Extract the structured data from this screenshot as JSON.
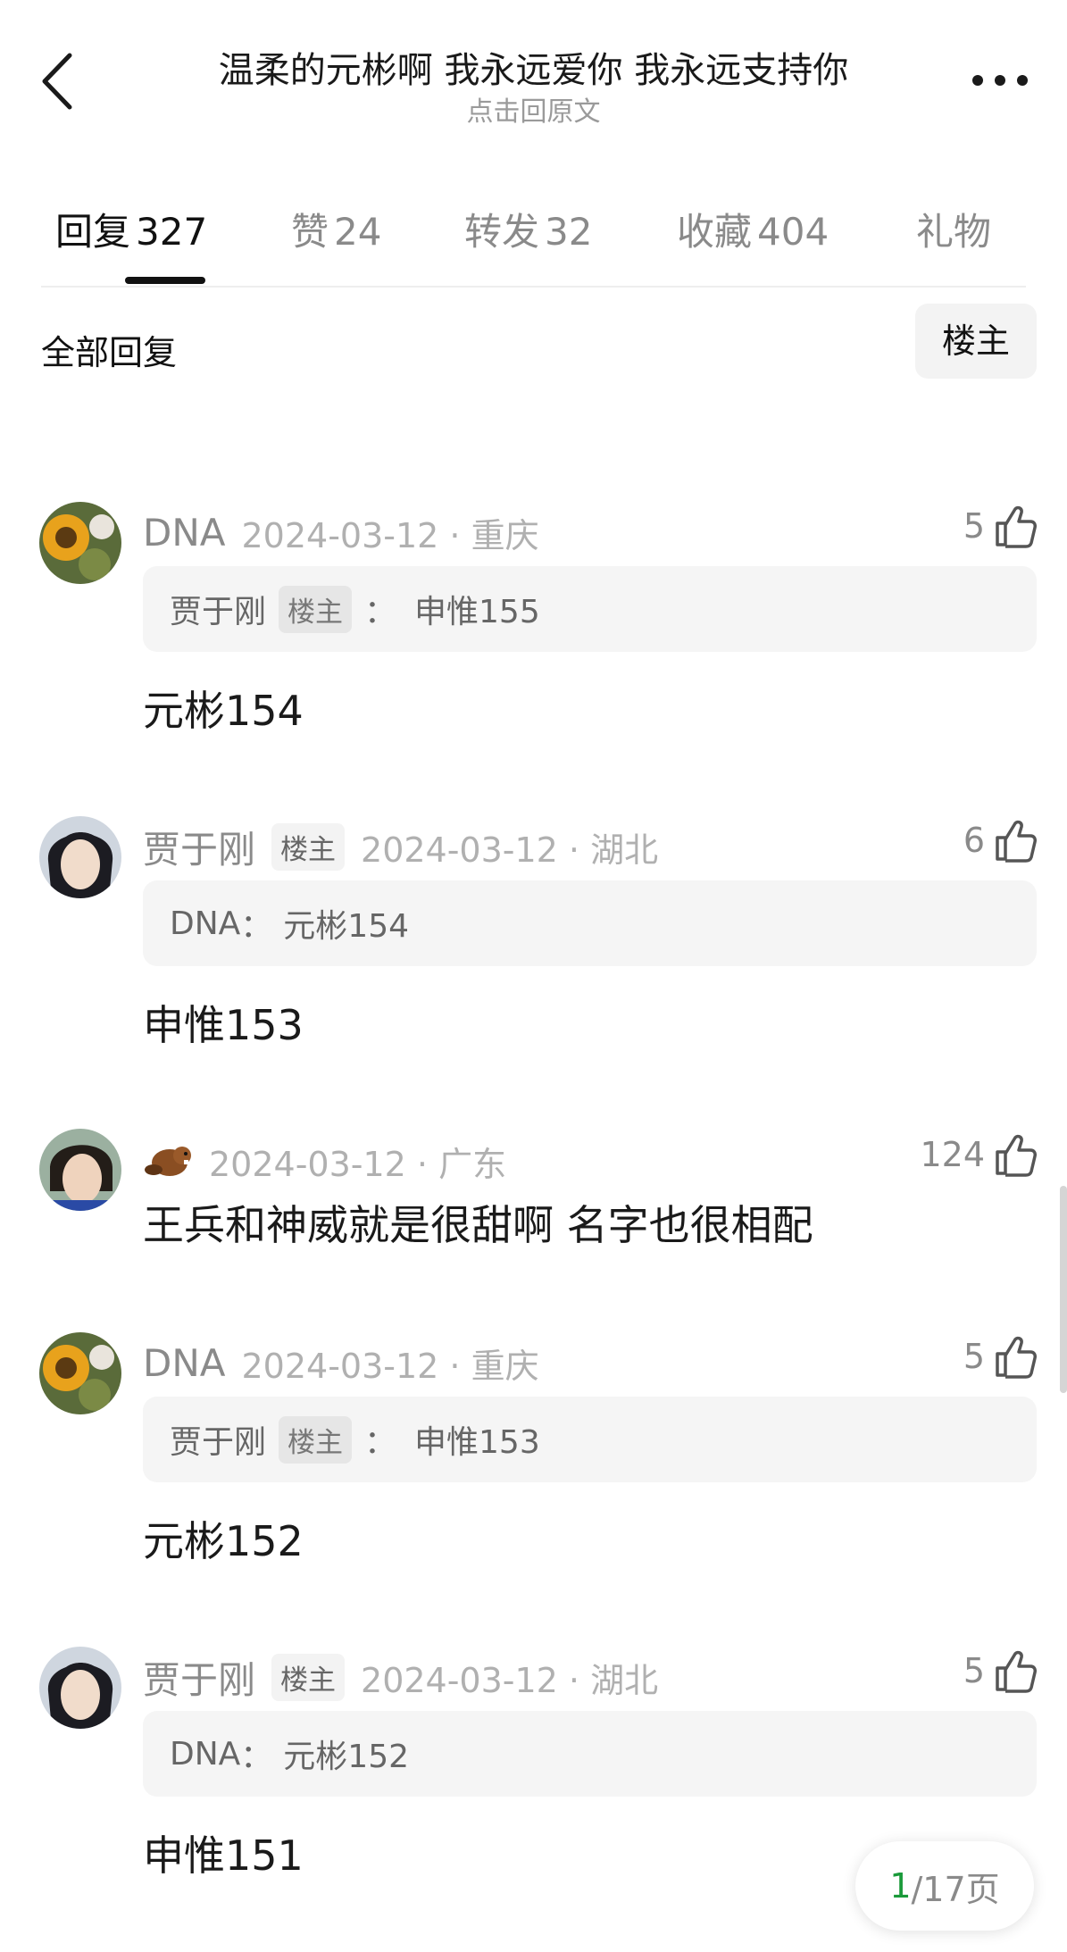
{
  "header": {
    "title": "温柔的元彬啊 我永远爱你 我永远支持你",
    "subtitle": "点击回原文",
    "back_icon": "chevron-left-icon",
    "more_icon": "more-dots-icon"
  },
  "tabs": [
    {
      "label": "回复",
      "count": "327",
      "active": true
    },
    {
      "label": "赞",
      "count": "24"
    },
    {
      "label": "转发",
      "count": "32"
    },
    {
      "label": "收藏",
      "count": "404"
    },
    {
      "label": "礼物",
      "count": ""
    }
  ],
  "filter": {
    "label": "全部回复",
    "owner_button": "楼主"
  },
  "replies": [
    {
      "username": "DNA",
      "badge": "",
      "date": "2024-03-12 · 重庆",
      "likes": "5",
      "quote": {
        "user": "贾于刚",
        "badge": "楼主",
        "sep": "：",
        "text": "申惟155"
      },
      "text": "元彬154",
      "avatar": "sunflower"
    },
    {
      "username": "贾于刚",
      "badge": "楼主",
      "date": "2024-03-12 · 湖北",
      "likes": "6",
      "quote": {
        "user": "DNA",
        "badge": "",
        "sep": "：",
        "text": "元彬154"
      },
      "text": "申惟153",
      "avatar": "person"
    },
    {
      "username": "",
      "badge": "",
      "date": "2024-03-12 · 广东",
      "likes": "124",
      "text": "王兵和神威就是很甜啊 名字也很相配",
      "avatar": "person2",
      "user_emoji": "beaver"
    },
    {
      "username": "DNA",
      "badge": "",
      "date": "2024-03-12 · 重庆",
      "likes": "5",
      "quote": {
        "user": "贾于刚",
        "badge": "楼主",
        "sep": "：",
        "text": "申惟153"
      },
      "text": "元彬152",
      "avatar": "sunflower"
    },
    {
      "username": "贾于刚",
      "badge": "楼主",
      "date": "2024-03-12 · 湖北",
      "likes": "5",
      "quote": {
        "user": "DNA",
        "badge": "",
        "sep": "：",
        "text": "元彬152"
      },
      "text": "申惟151",
      "avatar": "person"
    }
  ],
  "pager": {
    "current": "1",
    "total": "/17页"
  },
  "colors": {
    "accent_green": "#1a9a3a",
    "muted": "#8a8a8a",
    "quote_bg": "#f5f5f5"
  }
}
